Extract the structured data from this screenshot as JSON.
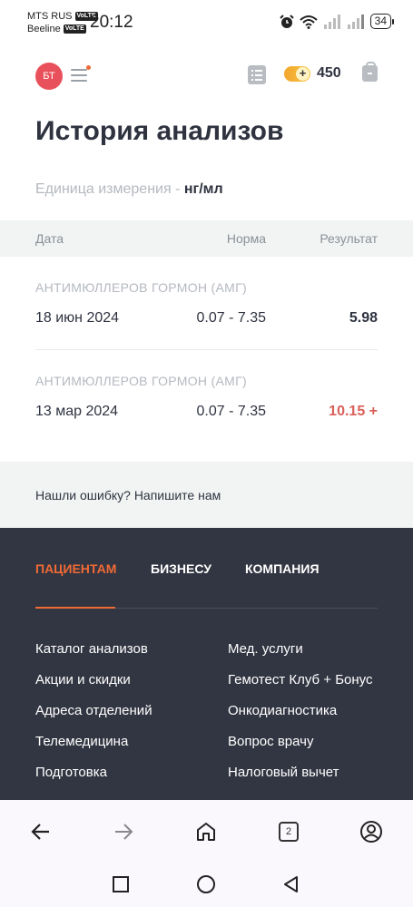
{
  "status_bar": {
    "carrier1": "MTS RUS",
    "carrier2": "Beeline",
    "volte": "VoLTE",
    "time": "20:12",
    "battery": "34"
  },
  "header": {
    "avatar_initials": "БТ",
    "points": "450"
  },
  "page": {
    "title": "История анализов",
    "unit_label": "Единица измерения - ",
    "unit_value": "нг/мл"
  },
  "table": {
    "headers": {
      "date": "Дата",
      "norm": "Норма",
      "result": "Результат"
    },
    "rows": [
      {
        "name": "АНТИМЮЛЛЕРОВ ГОРМОН (АМГ)",
        "date": "18 июн 2024",
        "norm": "0.07 - 7.35",
        "value": "5.98"
      },
      {
        "name": "АНТИМЮЛЛЕРОВ ГОРМОН (АМГ)",
        "date": "13 мар 2024",
        "norm": "0.07 - 7.35",
        "value": "10.15 +"
      }
    ]
  },
  "feedback": {
    "text": "Нашли ошибку? Напишите нам"
  },
  "footer": {
    "tabs": [
      "ПАЦИЕНТАМ",
      "БИЗНЕСУ",
      "КОМПАНИЯ"
    ],
    "links_left": [
      "Каталог анализов",
      "Акции и скидки",
      "Адреса отделений",
      "Телемедицина",
      "Подготовка"
    ],
    "links_right": [
      "Мед. услуги",
      "Гемотест Клуб + Бонус",
      "Онкодиагностика",
      "Вопрос врачу",
      "Налоговый вычет"
    ]
  },
  "browser": {
    "tab_count": "2"
  },
  "colors": {
    "accent": "#f06a35",
    "danger": "#d9605a",
    "footer_bg": "#323642",
    "avatar": "#e8515b"
  }
}
